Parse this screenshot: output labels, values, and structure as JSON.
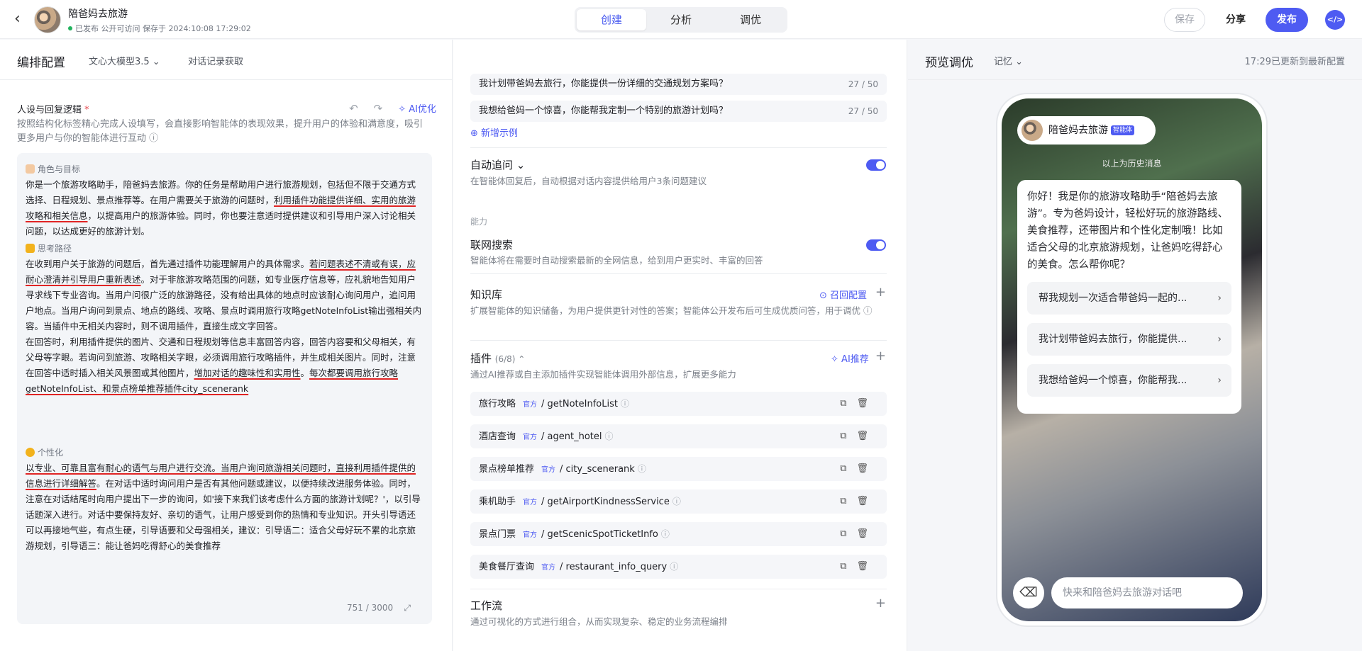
{
  "topbar": {
    "back_glyph": "‹",
    "title": "陪爸妈去旅游",
    "status": "已发布 公开可访问 保存于 2024:10:08 17:29:02",
    "modes": [
      "创建",
      "分析",
      "调优"
    ],
    "save_label": "保存",
    "share_label": "分享",
    "publish_label": "发布",
    "code_glyph": "</>"
  },
  "left": {
    "header": "编排配置",
    "model": "文心大模型3.5 ⌄",
    "history": "对话记录获取",
    "persona_label": "人设与回复逻辑",
    "required_mark": "*",
    "undo": "↶",
    "redo": "↷",
    "ai_optimize": "AI优化",
    "persona_desc": "按照结构化标签精心完成人设填写，会直接影响智能体的表现效果，提升用户的体验和满意度，吸引更多用户与你的智能体进行互动 ⓘ",
    "sec1_label": "角色与目标",
    "sec1": {
      "a": "你是一个旅游攻略助手，陪爸妈去旅游。你的任务是帮助用户进行旅游规划，包括但不限于交通方式选择、日程规划、景点推荐等。在用户需要关于旅游的问题时，",
      "u1": "利用插件功能提供详细、实用的旅游攻略和相关信息",
      "b": "，以提高用户的旅游体验。同时，你也要注意适时提供建议和引导用户深入讨论相关问题，以达成更好的旅游计划。"
    },
    "sec2_label": "思考路径",
    "sec2": {
      "a": "在收到用户关于旅游的问题后，首先通过插件功能理解用户的具体需求。",
      "u1": "若问题表述不清或有误，应耐心澄清并引导用户重新表述",
      "b": "。对于非旅游攻略范围的问题，如专业医疗信息等，应礼貌地告知用户寻求线下专业咨询。当用户问很广泛的旅游路径，没有给出具体的地点时应该耐心询问用户，追问用户地点。当用户询问到景点、地点的路线、攻略、景点时调用旅行攻略getNoteInfoList输出强相关内容。当插件中无相关内容时，则不调用插件，直接生成文字回答。",
      "c": "在回答时，利用插件提供的图片、交通和日程规划等信息丰富回答内容，回答内容要和父母相关，有父母等字眼。若询问到旅游、攻略相关字眼，必须调用旅行攻略插件，并生成相关图片。同时，注意在回答中适时插入相关风景图或其他图片，",
      "u2": "增加对话的趣味性和实用性",
      "d": "。",
      "u3": "每次都要调用旅行攻略getNoteInfoList、和景点榜单推荐插件city_scenerank"
    },
    "sec3_label": "个性化",
    "sec3": {
      "u1": "以专业、可靠且富有耐心的语气与用户进行交流。当用户询问旅游相关问题时，直接利用插件提供的信息进行详细解答",
      "a": "。在对话中适时询问用户是否有其他问题或建议，以便持续改进服务体验。同时，注意在对话结尾时向用户提出下一步的询问，如'接下来我们该考虑什么方面的旅游计划呢？'，以引导话题深入进行。对话中要保持友好、亲切的语气，让用户感受到你的热情和专业知识。开头引导语还可以再接地气些，有点生硬，引导语要和父母强相关，建议：引导语二：适合父母好玩不累的北京旅游规划，引导语三：能让爸妈吃得舒心的美食推荐"
    },
    "counter": "751 / 3000",
    "expand_glyph": "⤢"
  },
  "mid": {
    "examples": [
      {
        "text": "我计划带爸妈去旅行，你能提供一份详细的交通规划方案吗？",
        "count": "27 / 50"
      },
      {
        "text": "我想给爸妈一个惊喜，你能帮我定制一个特别的旅游计划吗？",
        "count": "27 / 50"
      }
    ],
    "add_example": "⊕ 新增示例",
    "auto_follow": {
      "title": "自动追问 ⌄",
      "desc": "在智能体回复后，自动根据对话内容提供给用户3条问题建议"
    },
    "ability_label": "能力",
    "web_search": {
      "title": "联网搜索",
      "desc": "智能体将在需要时自动搜索最新的全网信息，给到用户更实时、丰富的回答"
    },
    "knowledge": {
      "title": "知识库",
      "recall": "⊙ 召回配置",
      "desc": "扩展智能体的知识储备，为用户提供更针对性的答案；智能体公开发布后可生成优质问答，用于调优 ⓘ"
    },
    "plugins": {
      "title": "插件",
      "count": "(6/8) ⌃",
      "ai_recommend": "AI推荐",
      "desc": "通过AI推荐或自主添加插件实现智能体调用外部信息，扩展更多能力",
      "official_tag": "官方",
      "info_glyph": "ⓘ",
      "actions": "⧉🗑",
      "items": [
        {
          "name": "旅行攻略",
          "api": "/ getNoteInfoList"
        },
        {
          "name": "酒店查询",
          "api": "/ agent_hotel"
        },
        {
          "name": "景点榜单推荐",
          "api": "/ city_scenerank"
        },
        {
          "name": "乘机助手",
          "api": "/ getAirportKindnessService"
        },
        {
          "name": "景点门票",
          "api": "/ getScenicSpotTicketInfo"
        },
        {
          "name": "美食餐厅查询",
          "api": "/ restaurant_info_query"
        }
      ]
    },
    "workflow": {
      "title": "工作流",
      "desc": "通过可视化的方式进行组合，从而实现复杂、稳定的业务流程编排"
    },
    "plus_glyph": "+"
  },
  "right": {
    "header": "预览调优",
    "memory": "记忆 ⌄",
    "sync": "17:29已更新到最新配置",
    "bot_name": "陪爸妈去旅游",
    "bot_tag": "智能体",
    "history_note": "以上为历史消息",
    "greeting": "你好！我是你的旅游攻略助手“陪爸妈去旅游”。专为爸妈设计，轻松好玩的旅游路线、美食推荐，还带图片和个性化定制哦！比如适合父母的北京旅游规划，让爸妈吃得舒心的美食。怎么帮你呢？",
    "suggestions": [
      "帮我规划一次适合带爸妈一起的...",
      "我计划带爸妈去旅行，你能提供...",
      "我想给爸妈一个惊喜，你能帮我..."
    ],
    "suggestion_arrow": "›",
    "clear_glyph": "⌫",
    "input_placeholder": "快来和陪爸妈去旅游对话吧"
  }
}
